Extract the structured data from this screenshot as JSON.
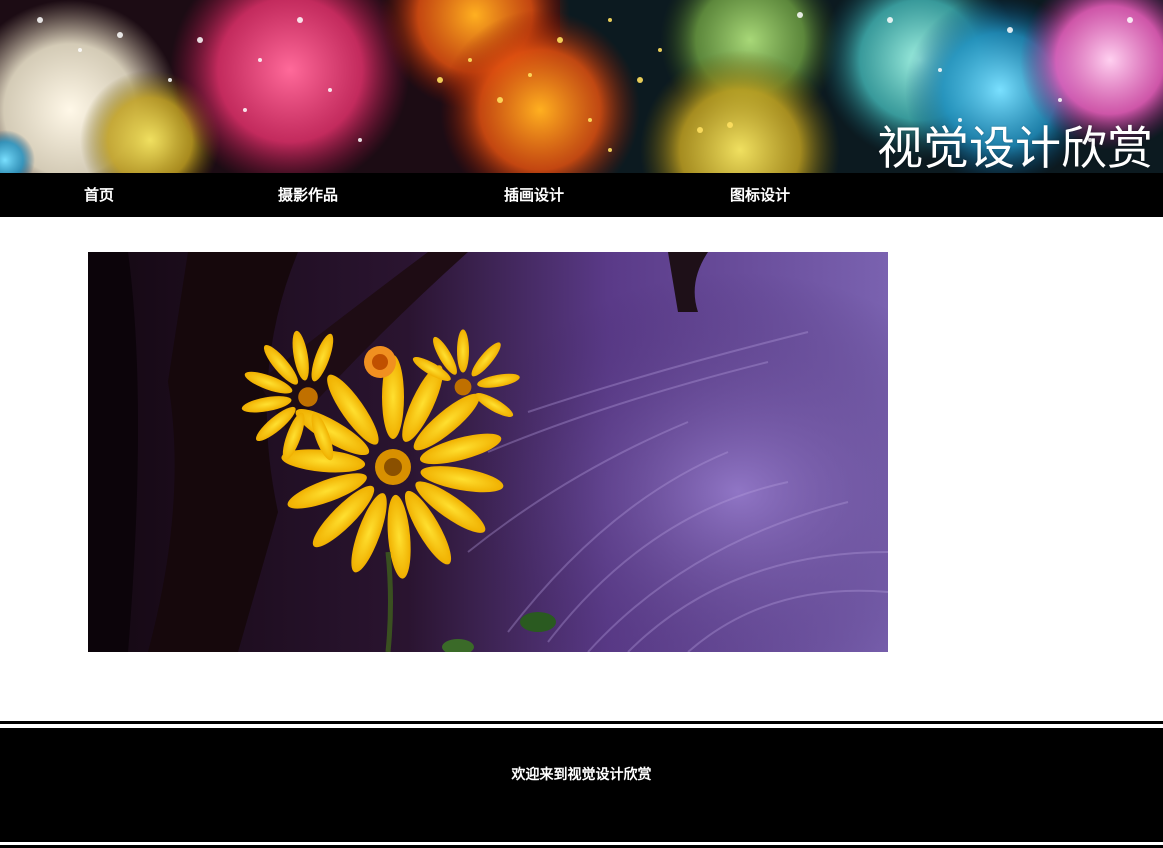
{
  "header": {
    "site_title": "视觉设计欣赏",
    "banner_image": "colorful-bokeh-lights"
  },
  "nav": {
    "items": [
      {
        "label": "首页"
      },
      {
        "label": "摄影作品"
      },
      {
        "label": "插画设计"
      },
      {
        "label": "图标设计"
      }
    ]
  },
  "main": {
    "hero_image": "yellow-flower-purple-grass-photo"
  },
  "footer": {
    "text": "欢迎来到视觉设计欣赏"
  },
  "colors": {
    "nav_background": "#000000",
    "nav_text": "#ffffff",
    "page_background": "#ffffff",
    "footer_background": "#000000"
  }
}
